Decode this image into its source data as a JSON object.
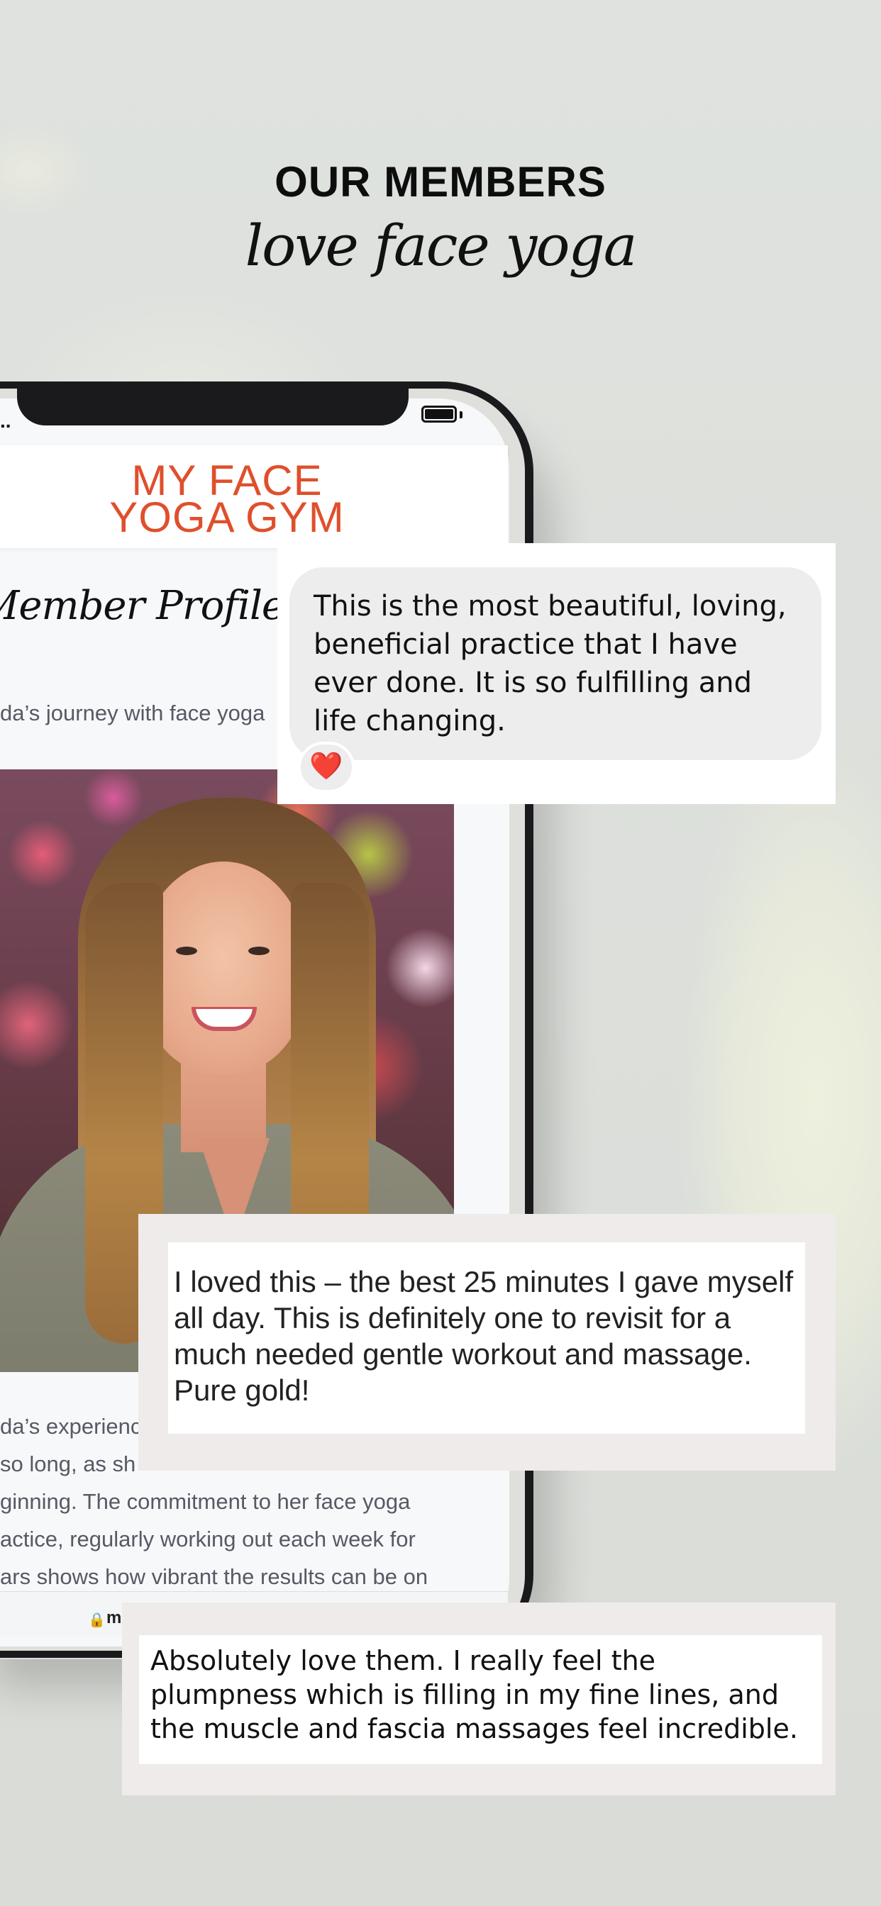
{
  "page": {
    "headline": "OUR MEMBERS",
    "subheadline": "love face yoga"
  },
  "phone": {
    "status_signal": "..",
    "logo": {
      "line1": "MY FACE",
      "line2": "YOGA GYM"
    },
    "article": {
      "title": "Member Profile: N",
      "subtitle": "da’s journey with face yoga",
      "body_lines": [
        "da’s experienc",
        " so long, as sh",
        "ginning. The commitment to her face yoga",
        "actice, regularly working out each week for",
        "ars shows how vibrant the results can be on"
      ]
    },
    "address_bar": {
      "url_fragment": "m"
    }
  },
  "reviews": [
    {
      "text": "This is the most beautiful, loving, beneficial practice that I have ever done. It is so fulfilling and life changing.",
      "reaction": "❤️"
    },
    {
      "text": "I loved this – the best 25 minutes I gave myself all day. This is definitely one to revisit for a much needed gentle workout and massage. Pure gold!"
    },
    {
      "text": "Absolutely love them. I really feel the plumpness which is filling in my fine lines, and the muscle and fascia massages feel incredible."
    }
  ],
  "colors": {
    "brand_logo": "#e04f2c",
    "background": "#dcdfdb",
    "bubble": "#ededed",
    "card_frame": "#eeebea"
  },
  "icons": [
    "lock-icon",
    "battery-icon",
    "heart-icon"
  ]
}
